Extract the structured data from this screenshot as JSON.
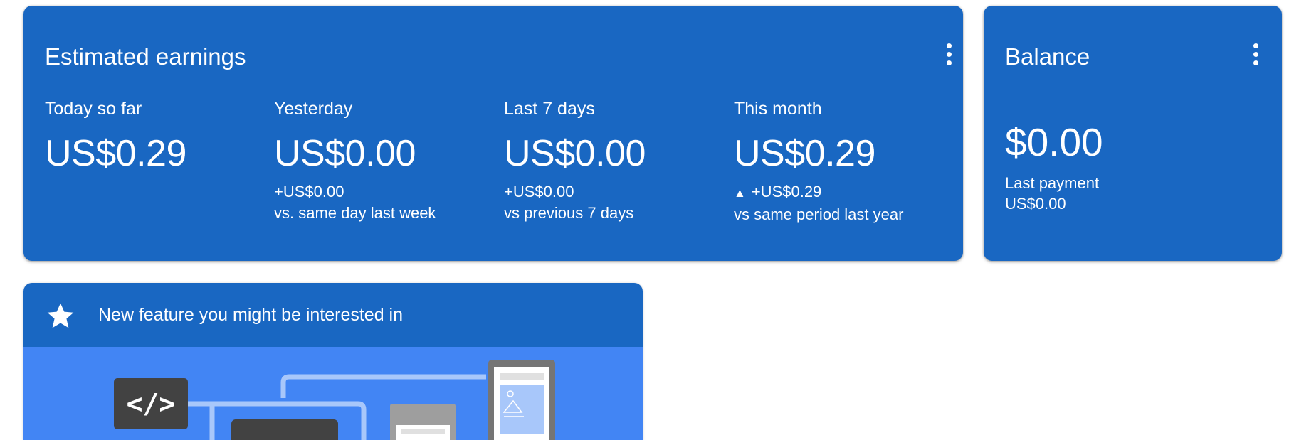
{
  "earnings": {
    "title": "Estimated earnings",
    "metrics": [
      {
        "label": "Today so far",
        "value": "US$0.29",
        "change": "",
        "compare": ""
      },
      {
        "label": "Yesterday",
        "value": "US$0.00",
        "change": "+US$0.00",
        "compare": "vs. same day last week"
      },
      {
        "label": "Last 7 days",
        "value": "US$0.00",
        "change": "+US$0.00",
        "compare": "vs previous 7 days"
      },
      {
        "label": "This month",
        "value": "US$0.29",
        "change": "+US$0.29",
        "compare": "vs same period last year",
        "trend": "up"
      }
    ]
  },
  "balance": {
    "title": "Balance",
    "value": "$0.00",
    "last_payment_label": "Last payment",
    "last_payment_value": "US$0.00"
  },
  "feature": {
    "title": "New feature you might be interested in",
    "code_glyph": "</>"
  },
  "colors": {
    "card_blue": "#1967c2",
    "illustration_blue": "#4285f4",
    "text": "#ffffff"
  },
  "icons": [
    "more-vert-icon",
    "star-icon",
    "code-icon",
    "browser-window-icon",
    "mobile-phone-icon",
    "image-icon"
  ]
}
